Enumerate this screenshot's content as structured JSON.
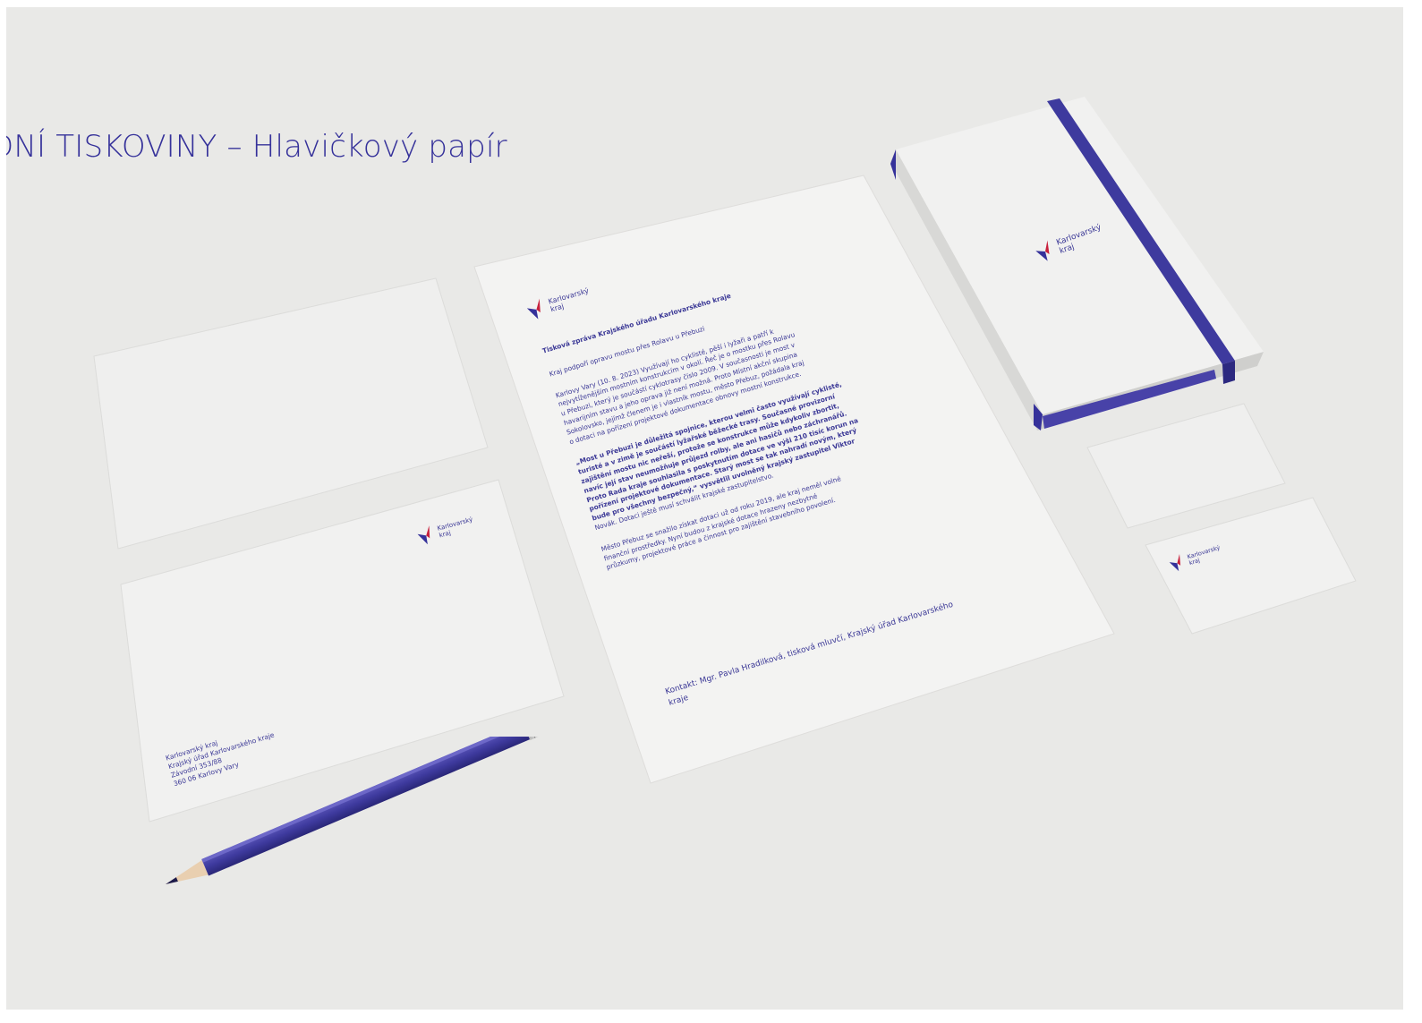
{
  "title": "DNÍ TISKOVINY – Hlavičkový papír",
  "brand": {
    "name_line1": "Karlovarský",
    "name_line2": "kraj",
    "color_blue": "#35319a",
    "color_red": "#c8203c"
  },
  "letter": {
    "heading": "Tisková zpráva Krajského úřadu Karlovarského kraje",
    "subheading": "Kraj podpoří opravu mostu přes Rolavu u Přebuzi",
    "para1": [
      "Karlovy Vary (10. 8. 2023) Využívají ho cyklisté, pěší i lyžaři a patří k",
      "nejvytíženějším mostním konstrukcím v okolí. Řeč je o mostku přes Rolavu",
      "u Přebuzi, který je součástí cyklotrasy číslo 2009. V současnosti je most v",
      "havarijním stavu a jeho oprava již není možná. Proto Místní akční skupina",
      "Sokolovsko, jejímž členem je i vlastník mostu, město Přebuz, požádala kraj",
      "o dotaci na pořízení projektové dokumentace obnovy mostní konstrukce."
    ],
    "para2": [
      "„Most u Přebuzi je důležitá spojnice, kterou velmi často využívají cyklisté,",
      "turisté a v zimě je součástí lyžařské běžecké trasy. Současné provizorní",
      "zajištění mostu nic neřeší, protože se konstrukce může kdykoliv zbortit,",
      "navíc její stav neumožňuje průjezd rolby, ale ani hasičů nebo záchranářů.",
      "Proto Rada kraje souhlasila s poskytnutím dotace ve výši 210 tisíc korun na",
      "pořízení projektové dokumentace. Starý most se tak nahradí novým, který",
      "bude pro všechny bezpečný,“ vysvětlil uvolněný krajský zastupitel Viktor",
      "Novák. Dotaci ještě musí schválit krajské zastupitelstvo."
    ],
    "para3": [
      "Město Přebuz se snažilo získat dotaci už od roku 2019, ale kraj neměl volné",
      "finanční prostředky. Nyní budou z krajské dotace hrazeny nezbytné",
      "průzkumy, projektové práce a činnost pro zajištění stavebního povolení."
    ],
    "contact": [
      "Kontakt: Mgr. Pavla Hradilková, tisková mluvčí, Krajský úřad Karlovarského",
      "kraje"
    ]
  },
  "envelope": {
    "address": [
      "Karlovarský kraj",
      "Krajský úřad Karlovarského kraje",
      "Závodní 353/88",
      "360 06  Karlovy Vary"
    ]
  }
}
